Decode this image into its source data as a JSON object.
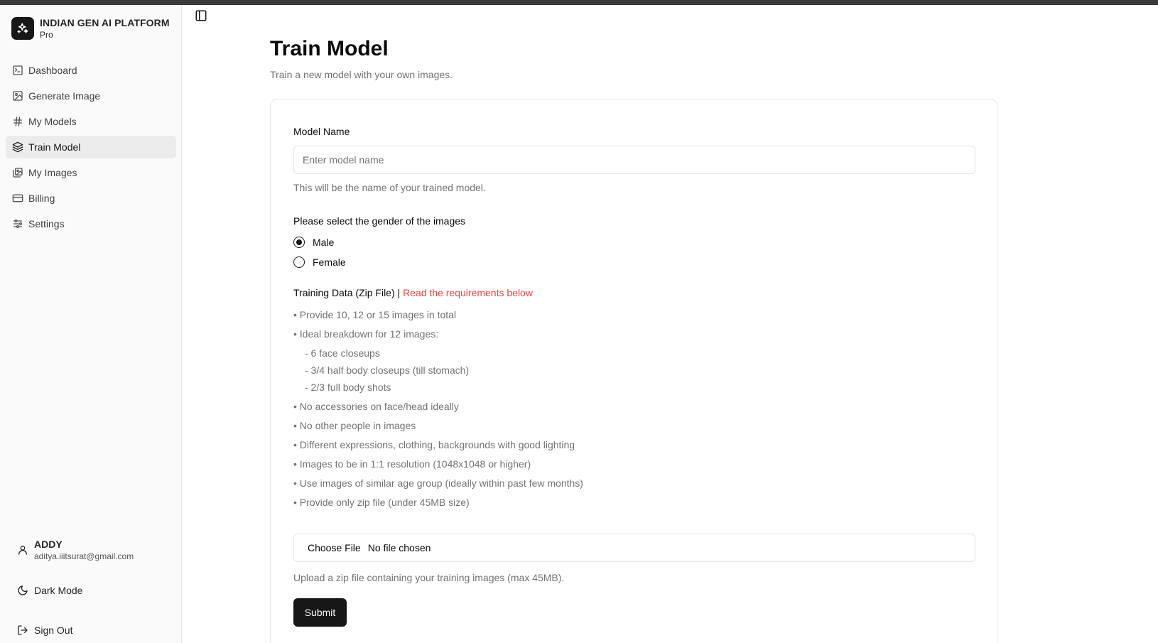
{
  "brand": {
    "name": "INDIAN GEN AI PLATFORM",
    "plan": "Pro"
  },
  "nav": [
    {
      "label": "Dashboard",
      "icon": "dashboard-icon",
      "active": false
    },
    {
      "label": "Generate Image",
      "icon": "image-icon",
      "active": false
    },
    {
      "label": "My Models",
      "icon": "hash-icon",
      "active": false
    },
    {
      "label": "Train Model",
      "icon": "layers-icon",
      "active": true
    },
    {
      "label": "My Images",
      "icon": "images-icon",
      "active": false
    },
    {
      "label": "Billing",
      "icon": "credit-card-icon",
      "active": false
    },
    {
      "label": "Settings",
      "icon": "sliders-icon",
      "active": false
    }
  ],
  "user": {
    "name": "ADDY",
    "email": "aditya.iiitsurat@gmail.com"
  },
  "sidebar_actions": {
    "dark_mode": "Dark Mode",
    "sign_out": "Sign Out"
  },
  "page": {
    "title": "Train Model",
    "subtitle": "Train a new model with your own images."
  },
  "form": {
    "model_name_label": "Model Name",
    "model_name_placeholder": "Enter model name",
    "model_name_value": "",
    "model_name_help": "This will be the name of your trained model.",
    "gender_label": "Please select the gender of the images",
    "gender_options": [
      "Male",
      "Female"
    ],
    "gender_selected": "Male",
    "training_label": "Training Data (Zip File) | ",
    "training_link": "Read the requirements below",
    "requirements": [
      "• Provide 10, 12 or 15 images in total",
      "• Ideal breakdown for 12 images:",
      "- 6 face closeups",
      "- 3/4 half body closeups (till stomach)",
      "- 2/3 full body shots",
      "• No accessories on face/head ideally",
      "• No other people in images",
      "• Different expressions, clothing, backgrounds with good lighting",
      "• Images to be in 1:1 resolution (1048x1048 or higher)",
      "• Use images of similar age group (ideally within past few months)",
      "• Provide only zip file (under 45MB size)"
    ],
    "file_button": "Choose File",
    "file_status": "No file chosen",
    "file_help": "Upload a zip file containing your training images (max 45MB).",
    "submit_label": "Submit"
  },
  "colors": {
    "accent": "#171717",
    "link": "#ef4444",
    "muted": "#737373",
    "sidebar_bg": "#fafafa",
    "active_bg": "#ececec"
  }
}
